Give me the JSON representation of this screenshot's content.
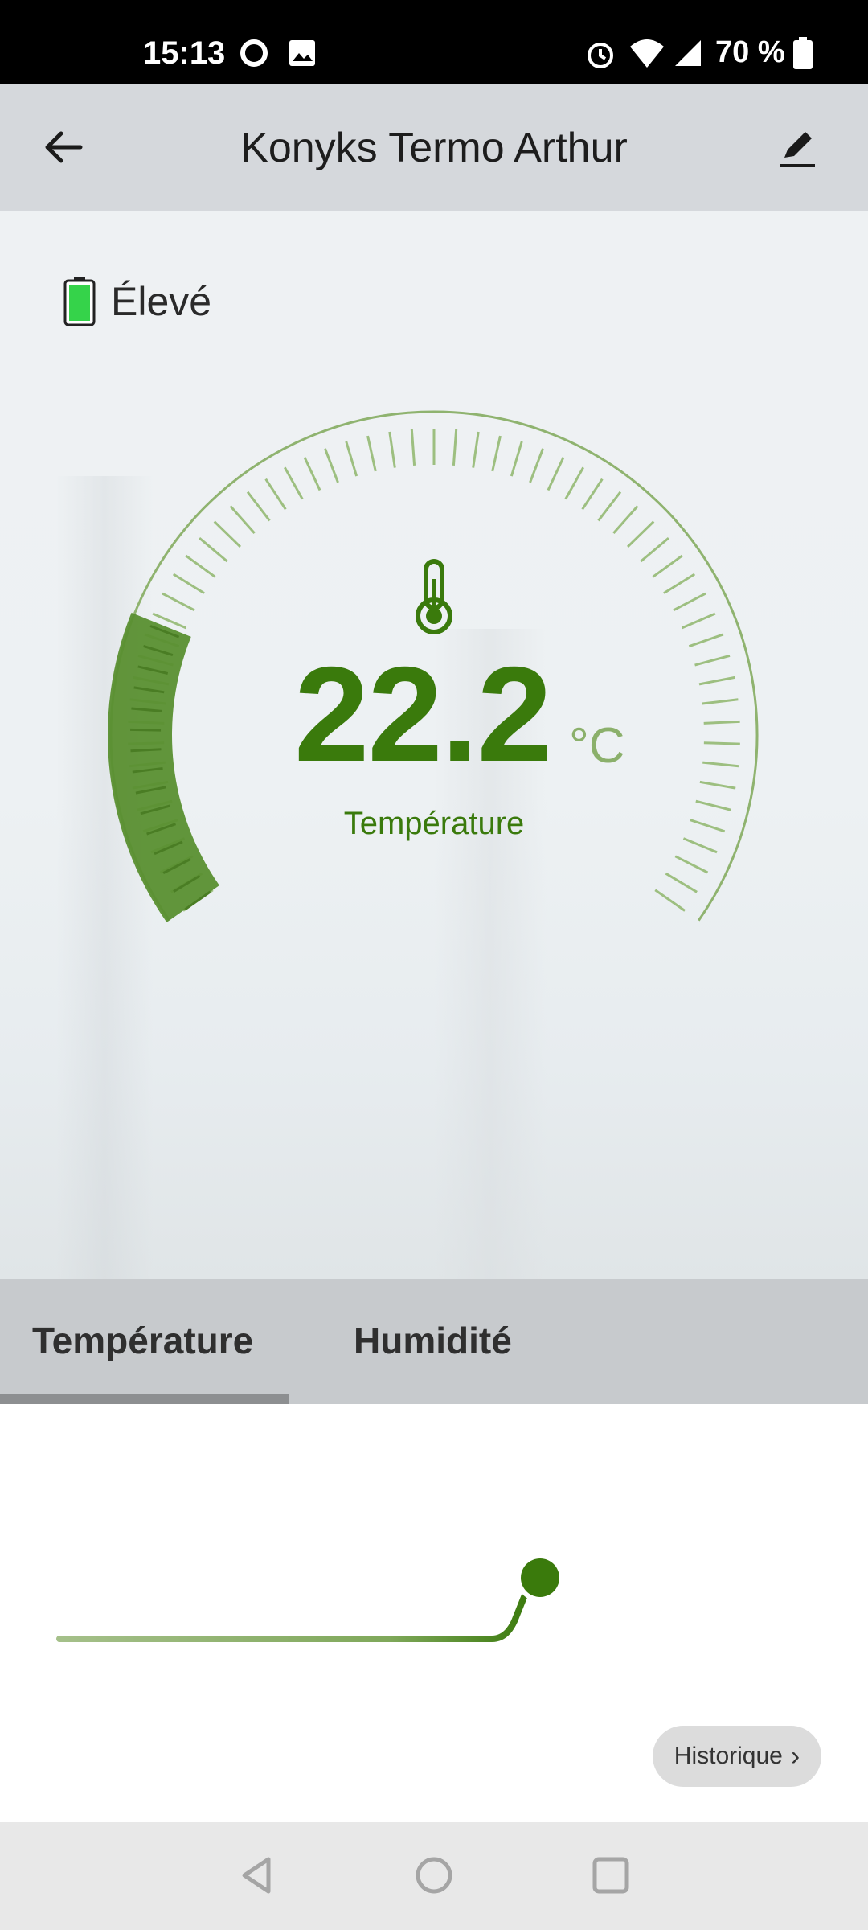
{
  "status_bar": {
    "time": "15:13",
    "battery": "70 %"
  },
  "app_bar": {
    "title": "Konyks Termo Arthur"
  },
  "battery_status": {
    "label": "Élevé"
  },
  "gauge": {
    "value": "22.2",
    "unit": "°C",
    "label": "Température",
    "color": "#3a7a0c",
    "fill_color": "#5a8f30"
  },
  "tabs": [
    {
      "label": "Température",
      "selected": true
    },
    {
      "label": "Humidité",
      "selected": false
    }
  ],
  "history_button": {
    "label": "Historique"
  },
  "icons": {
    "back": "arrow-left-icon",
    "edit": "pencil-icon",
    "thermometer": "thermometer-icon",
    "battery": "battery-icon",
    "nav_back": "triangle-back-icon",
    "nav_home": "circle-home-icon",
    "nav_recents": "square-recents-icon"
  }
}
